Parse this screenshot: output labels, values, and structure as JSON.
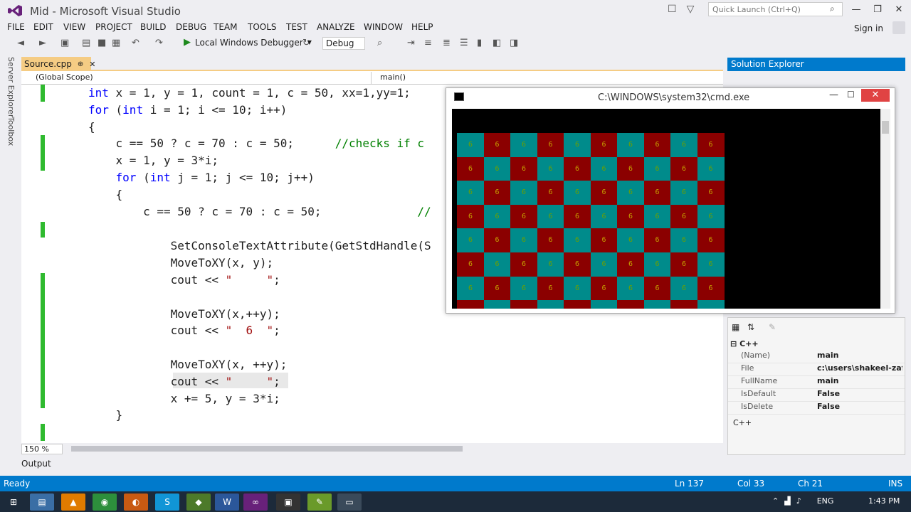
{
  "window": {
    "title": "Mid - Microsoft Visual Studio"
  },
  "quick_launch": {
    "placeholder": "Quick Launch (Ctrl+Q)"
  },
  "menu": [
    "FILE",
    "EDIT",
    "VIEW",
    "PROJECT",
    "BUILD",
    "DEBUG",
    "TEAM",
    "TOOLS",
    "TEST",
    "ANALYZE",
    "WINDOW",
    "HELP"
  ],
  "signin": "Sign in",
  "toolbar": {
    "debugger_label": "Local Windows Debugger",
    "config": "Debug"
  },
  "side_tabs": [
    "Server Explorer",
    "Toolbox"
  ],
  "editor": {
    "tab": "Source.cpp",
    "scope": "(Global Scope)",
    "function": "main()",
    "lines": [
      {
        "segments": [
          {
            "t": "int",
            "k": "kw"
          },
          {
            "t": " x = 1, y = 1, count = 1, c = 50, xx=1,yy=1;"
          }
        ]
      },
      {
        "segments": [
          {
            "t": "for",
            "k": "kw"
          },
          {
            "t": " ("
          },
          {
            "t": "int",
            "k": "kw"
          },
          {
            "t": " i = 1; i <= 10; i++)"
          }
        ]
      },
      {
        "segments": [
          {
            "t": "{"
          }
        ]
      },
      {
        "segments": [
          {
            "t": "    c == 50 ? c = 70 : c = 50;      "
          },
          {
            "t": "//checks if c",
            "k": "cm"
          }
        ]
      },
      {
        "segments": [
          {
            "t": "    x = 1, y = 3*i;"
          }
        ]
      },
      {
        "segments": [
          {
            "t": "    "
          },
          {
            "t": "for",
            "k": "kw"
          },
          {
            "t": " ("
          },
          {
            "t": "int",
            "k": "kw"
          },
          {
            "t": " j = 1; j <= 10; j++)"
          }
        ]
      },
      {
        "segments": [
          {
            "t": "    {"
          }
        ]
      },
      {
        "segments": [
          {
            "t": "        c == 50 ? c = 70 : c = 50;              "
          },
          {
            "t": "//",
            "k": "cm"
          }
        ]
      },
      {
        "segments": [
          {
            "t": ""
          }
        ]
      },
      {
        "segments": [
          {
            "t": "            SetConsoleTextAttribute(GetStdHandle(S"
          }
        ]
      },
      {
        "segments": [
          {
            "t": "            MoveToXY(x, y);"
          }
        ]
      },
      {
        "segments": [
          {
            "t": "            cout << "
          },
          {
            "t": "\"     \"",
            "k": "str"
          },
          {
            "t": ";"
          }
        ]
      },
      {
        "segments": [
          {
            "t": ""
          }
        ]
      },
      {
        "segments": [
          {
            "t": "            MoveToXY(x,++y);"
          }
        ]
      },
      {
        "segments": [
          {
            "t": "            cout << "
          },
          {
            "t": "\"  6  \"",
            "k": "str"
          },
          {
            "t": ";"
          }
        ]
      },
      {
        "segments": [
          {
            "t": ""
          }
        ]
      },
      {
        "segments": [
          {
            "t": "            MoveToXY(x, ++y);"
          }
        ]
      },
      {
        "segments": [
          {
            "t": "            cout << "
          },
          {
            "t": "\"     \"",
            "k": "str"
          },
          {
            "t": ";"
          }
        ]
      },
      {
        "segments": [
          {
            "t": "            x += 5, y = 3*i;"
          }
        ]
      },
      {
        "segments": [
          {
            "t": "    }"
          }
        ]
      }
    ]
  },
  "cmd": {
    "title": "C:\\WINDOWS\\system32\\cmd.exe",
    "cell_char": "6",
    "cols": 10,
    "rows": 7
  },
  "solution_explorer": {
    "title": "Solution Explorer"
  },
  "properties": {
    "category": "C++",
    "rows": [
      {
        "name": "(Name)",
        "value": "main"
      },
      {
        "name": "File",
        "value": "c:\\users\\shakeel-zafa"
      },
      {
        "name": "FullName",
        "value": "main"
      },
      {
        "name": "IsDefault",
        "value": "False"
      },
      {
        "name": "IsDelete",
        "value": "False"
      }
    ],
    "description": "C++"
  },
  "zoom": "150 %",
  "output_tab": "Output",
  "status": {
    "ready": "Ready",
    "ln": "Ln 137",
    "col": "Col 33",
    "ch": "Ch 21",
    "mode": "INS"
  },
  "taskbar": {
    "lang": "ENG",
    "time": "1:43 PM"
  },
  "colors": {
    "accent": "#007acc",
    "cell_red": "#8b0000",
    "cell_teal": "#008b8b",
    "tab_active": "#f5cc84"
  }
}
